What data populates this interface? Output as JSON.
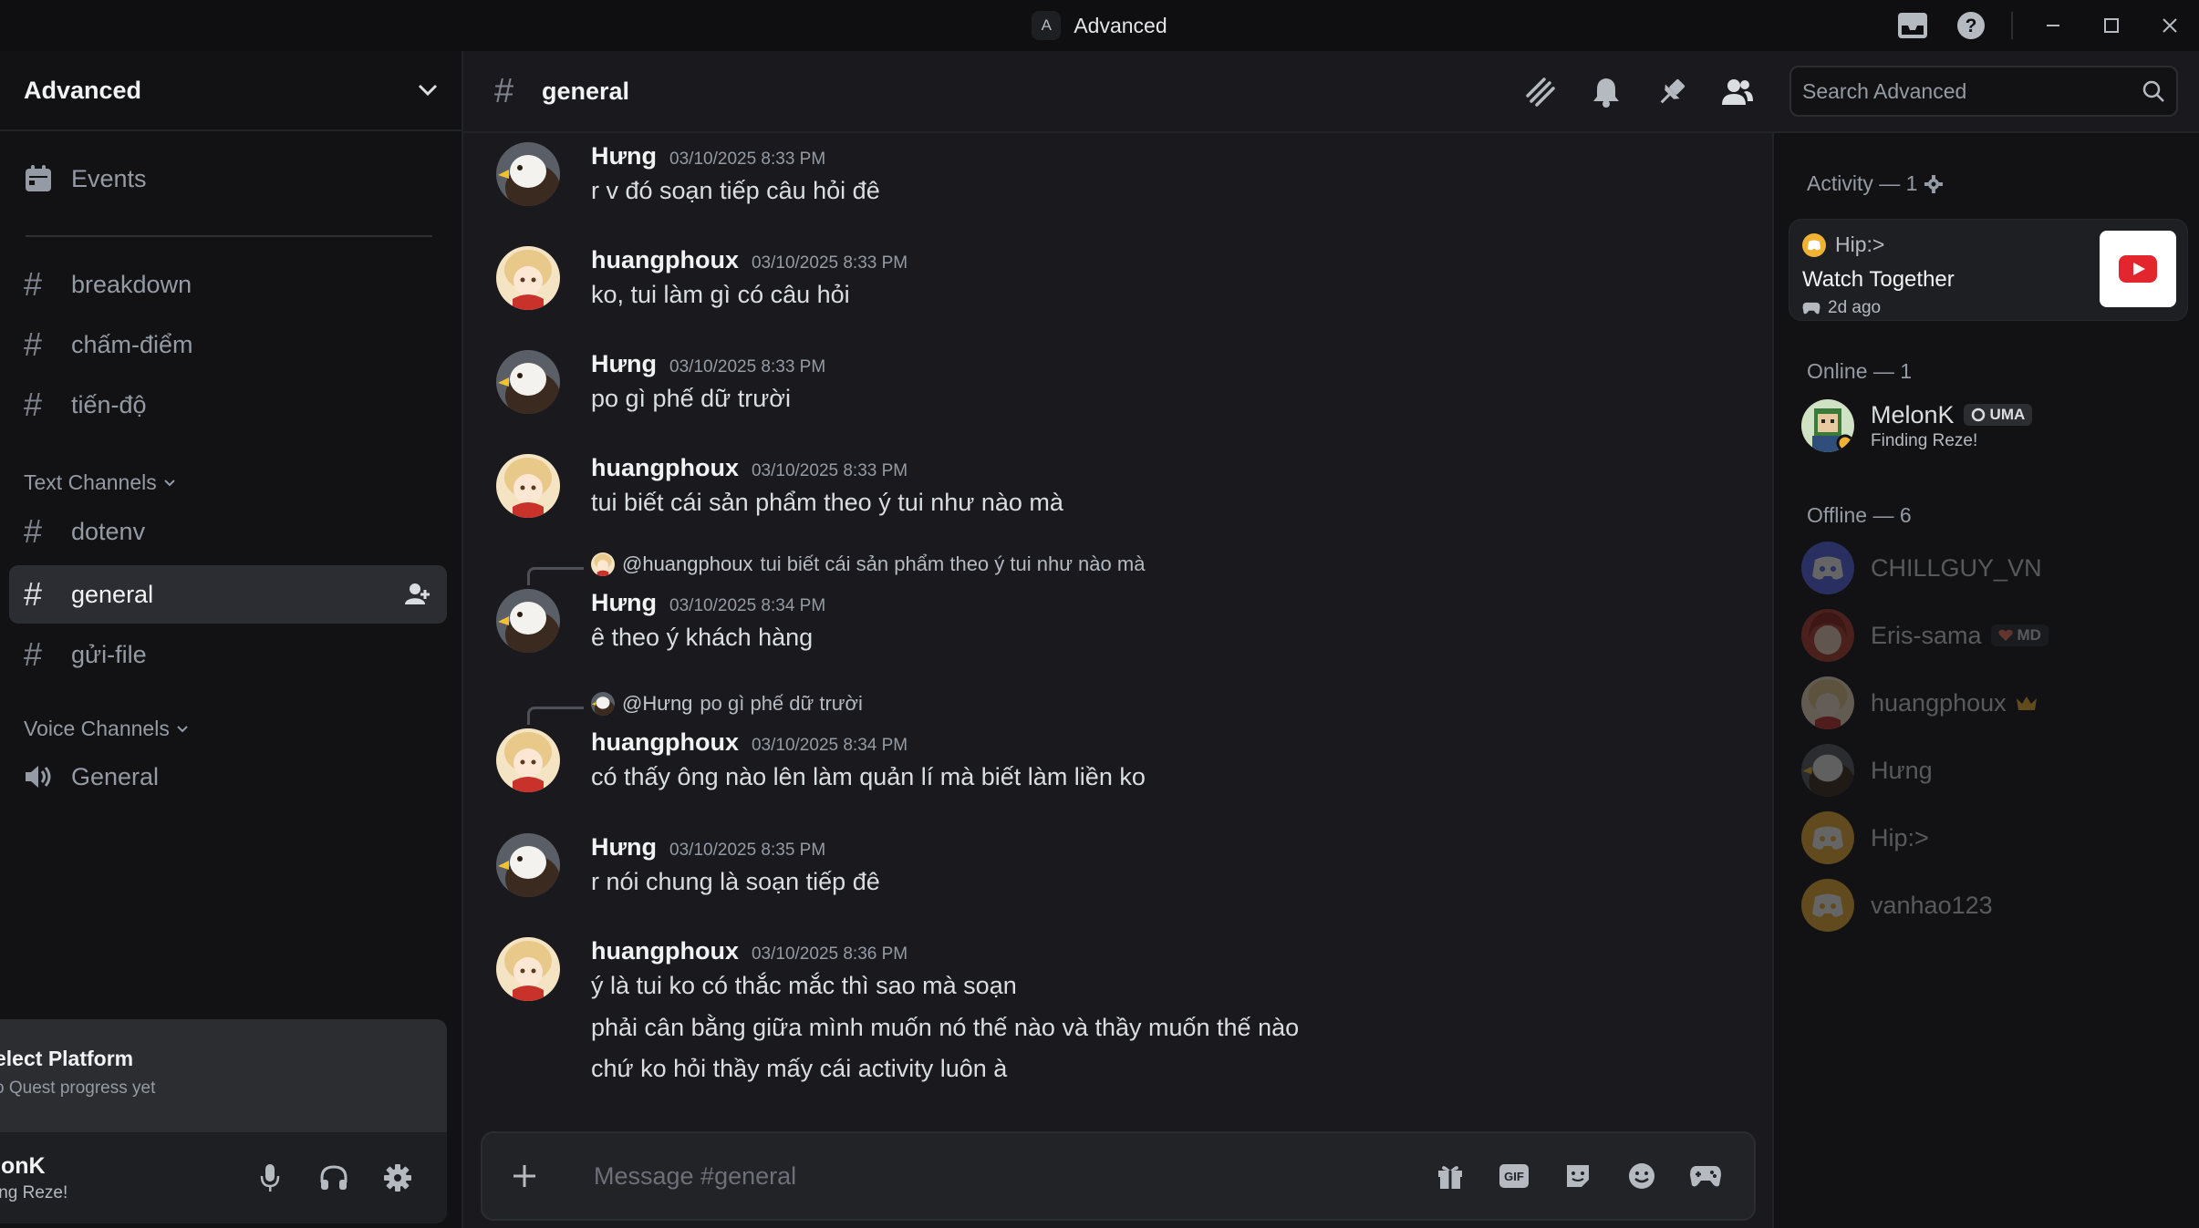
{
  "window": {
    "app_badge": "A",
    "title": "Advanced"
  },
  "server": {
    "name": "Advanced"
  },
  "sidebar": {
    "events_label": "Events",
    "top_channels": [
      "breakdown",
      "chấm-điểm",
      "tiến-độ"
    ],
    "text_category": "Text Channels",
    "text_channels": [
      "dotenv",
      "general",
      "gửi-file"
    ],
    "active_channel": "general",
    "voice_category": "Voice Channels",
    "voice_channels": [
      "General"
    ]
  },
  "quest": {
    "title": "elect Platform",
    "subtitle": "o Quest progress yet"
  },
  "user_panel": {
    "name": "lonK",
    "status": "ing Reze!"
  },
  "chat": {
    "channel_name": "general",
    "search_placeholder": "Search Advanced",
    "composer_placeholder": "Message #general",
    "gif_label": "GIF",
    "messages": [
      {
        "author": "Hưng",
        "time": "03/10/2025 8:33 PM",
        "lines": [
          "r v đó soạn tiếp câu hỏi đê"
        ]
      },
      {
        "author": "huangphoux",
        "time": "03/10/2025 8:33 PM",
        "lines": [
          "ko, tui làm gì có câu hỏi"
        ]
      },
      {
        "author": "Hưng",
        "time": "03/10/2025 8:33 PM",
        "lines": [
          "po gì phế dữ trười"
        ]
      },
      {
        "author": "huangphoux",
        "time": "03/10/2025 8:33 PM",
        "lines": [
          "tui biết cái sản phẩm theo ý tui như nào mà"
        ]
      },
      {
        "author": "Hưng",
        "time": "03/10/2025 8:34 PM",
        "lines": [
          "ê theo ý khách hàng"
        ],
        "reply": {
          "user": "@huangphoux",
          "text": "tui biết cái sản phẩm theo ý tui như nào mà"
        }
      },
      {
        "author": "huangphoux",
        "time": "03/10/2025 8:34 PM",
        "lines": [
          "có thấy ông nào lên làm quản lí mà biết làm liền ko"
        ],
        "reply": {
          "user": "@Hưng",
          "text": "po gì phế dữ trười"
        }
      },
      {
        "author": "Hưng",
        "time": "03/10/2025 8:35 PM",
        "lines": [
          "r nói chung là soạn tiếp đê"
        ]
      },
      {
        "author": "huangphoux",
        "time": "03/10/2025 8:36 PM",
        "lines": [
          "ý là tui ko có thắc mắc thì sao mà soạn",
          "phải cân bằng giữa mình muốn nó thế nào và thầy muốn thế nào",
          "chứ ko hỏi thầy mấy cái activity luôn à"
        ]
      }
    ]
  },
  "members": {
    "activity_title": "Activity — 1",
    "activity": {
      "user": "Hip:>",
      "title": "Watch Together",
      "time": "2d ago"
    },
    "online_title": "Online — 1",
    "online": [
      {
        "name": "MelonK",
        "badge": "UMA",
        "status": "Finding Reze!"
      }
    ],
    "offline_title": "Offline — 6",
    "offline": [
      {
        "name": "CHILLGUY_VN",
        "avatar": "discord"
      },
      {
        "name": "Eris-sama",
        "badge": "MD",
        "avatar": "red"
      },
      {
        "name": "huangphoux",
        "crown": true,
        "avatar": "cream"
      },
      {
        "name": "Hưng",
        "avatar": "eagle"
      },
      {
        "name": "Hip:>",
        "avatar": "discord-orange"
      },
      {
        "name": "vanhao123",
        "avatar": "discord-orange"
      }
    ]
  },
  "colors": {
    "background": "#1a1a1e",
    "sidebar": "#121214",
    "active_channel_bg": "#2c2d32",
    "text_primary": "#f2f3f5",
    "text_muted": "#949ba4",
    "youtube_red": "#e3262e",
    "discord_blurple": "#5865f2",
    "discord_orange": "#f0b232"
  }
}
